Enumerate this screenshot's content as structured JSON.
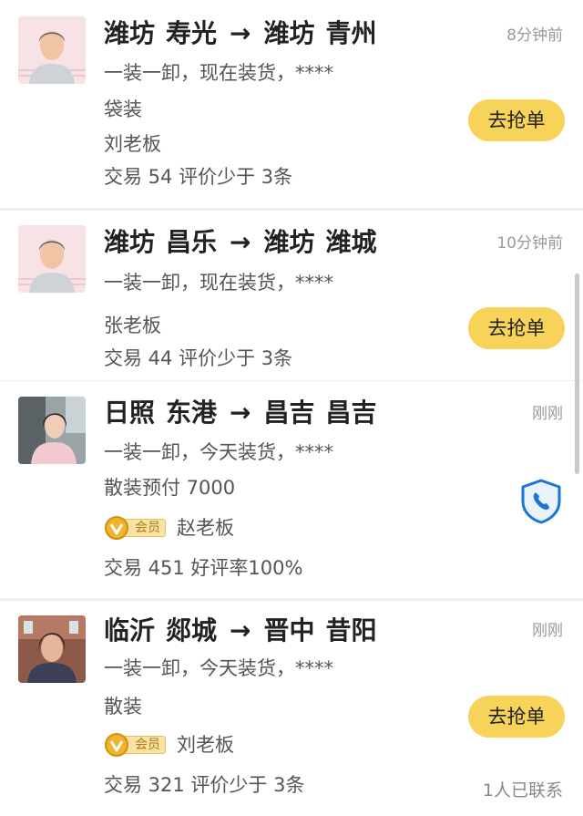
{
  "orders": [
    {
      "origin_city": "潍坊",
      "origin_district": "寿光",
      "dest_city": "潍坊",
      "dest_district": "青州",
      "time": "8分钟前",
      "load": "一装一卸，现在装货，****",
      "cargo": "袋装",
      "boss": "刘老板",
      "stats": "交易 54 评价少于 3条",
      "button": "去抢单"
    },
    {
      "origin_city": "潍坊",
      "origin_district": "昌乐",
      "dest_city": "潍坊",
      "dest_district": "潍城",
      "time": "10分钟前",
      "load": "一装一卸，现在装货，****",
      "boss": "张老板",
      "stats": "交易 44 评价少于 3条",
      "button": "去抢单"
    },
    {
      "origin_city": "日照",
      "origin_district": "东港",
      "dest_city": "昌吉",
      "dest_district": "昌吉",
      "time": "刚刚",
      "load": "一装一卸，今天装货，****",
      "cargo": "散装预付 7000",
      "vip_label": "会员",
      "boss": "赵老板",
      "stats": "交易 451 好评率100%"
    },
    {
      "origin_city": "临沂",
      "origin_district": "郯城",
      "dest_city": "晋中",
      "dest_district": "昔阳",
      "time": "刚刚",
      "load": "一装一卸，今天装货，****",
      "cargo": "散装",
      "vip_label": "会员",
      "boss": "刘老板",
      "stats": "交易 321 评价少于 3条",
      "button": "去抢单",
      "contacted": "1人已联系"
    }
  ],
  "arrow": "→",
  "colors": {
    "button": "#f8d35a",
    "shield": "#1976d2",
    "vip_gold": "#e6b422"
  }
}
